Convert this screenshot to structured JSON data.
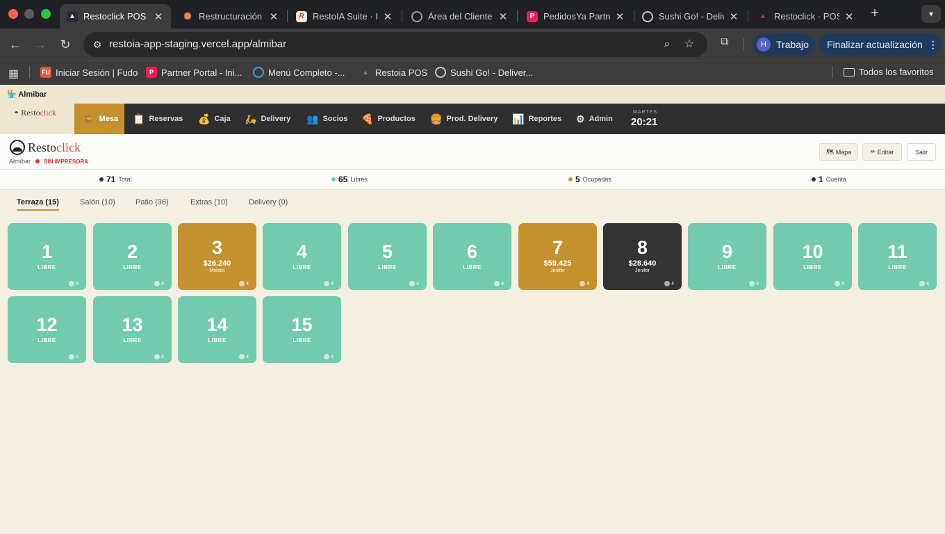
{
  "browser": {
    "tabs": [
      {
        "title": "Restoclick POS",
        "active": true
      },
      {
        "title": "Restructuración",
        "active": false
      },
      {
        "title": "RestoIA Suite · IA",
        "active": false
      },
      {
        "title": "Área del Cliente",
        "active": false
      },
      {
        "title": "PedidosYa Partner",
        "active": false
      },
      {
        "title": "Sushi Go! - Deliv",
        "active": false
      },
      {
        "title": "Restoclick · POS",
        "active": false
      }
    ],
    "url": "restoia-app-staging.vercel.app/almibar",
    "profile_label": "Trabajo",
    "profile_initial": "H",
    "update_label": "Finalizar actualización",
    "bookmarks": [
      {
        "label": "Iniciar Sesión | Fudo"
      },
      {
        "label": "Partner Portal - Ini..."
      },
      {
        "label": "Menú Completo -..."
      },
      {
        "label": "Restoia POS"
      },
      {
        "label": "Sushi Go! - Deliver..."
      }
    ],
    "all_bookmarks_label": "Todos los favoritos"
  },
  "app": {
    "venue_title": "Almibar",
    "nav": {
      "logo": {
        "part1": "Resto",
        "part2": "click"
      },
      "items": [
        {
          "label": "Mesa",
          "icon": "chair-icon",
          "active": true
        },
        {
          "label": "Reservas",
          "icon": "clipboard-icon"
        },
        {
          "label": "Caja",
          "icon": "money-bag-icon"
        },
        {
          "label": "Delivery",
          "icon": "scooter-icon"
        },
        {
          "label": "Socios",
          "icon": "people-icon"
        },
        {
          "label": "Productos",
          "icon": "pizza-icon"
        },
        {
          "label": "Prod. Delivery",
          "icon": "burger-icon"
        },
        {
          "label": "Reportes",
          "icon": "chart-icon"
        },
        {
          "label": "Admin",
          "icon": "gear-icon"
        }
      ],
      "day": "MARTES",
      "time": "20:21"
    },
    "header": {
      "brand": {
        "part1": "Resto",
        "part2": "click"
      },
      "venue": "Almíbar",
      "printer_status": "SIN IMPRESORA",
      "buttons": {
        "map": "Mapa",
        "edit": "Editar",
        "exit": "Salir"
      }
    },
    "stats": [
      {
        "value": "71",
        "label": "Total",
        "color": "#333333"
      },
      {
        "value": "65",
        "label": "Libres",
        "color": "#72cbae"
      },
      {
        "value": "5",
        "label": "Ocupadas",
        "color": "#c4912e"
      },
      {
        "value": "1",
        "label": "Cuenta",
        "color": "#333333"
      }
    ],
    "area_tabs": [
      {
        "label": "Terraza (15)",
        "active": true
      },
      {
        "label": "Salón (10)"
      },
      {
        "label": "Patio (36)"
      },
      {
        "label": "Extras (10)"
      },
      {
        "label": "Delivery (0)"
      }
    ],
    "tables": [
      {
        "number": "1",
        "status": "LIBRE",
        "capacity": "4"
      },
      {
        "number": "2",
        "status": "LIBRE",
        "capacity": "4"
      },
      {
        "number": "3",
        "status": "occupied",
        "amount": "$26.240",
        "waiter": "Moises",
        "capacity": "4"
      },
      {
        "number": "4",
        "status": "LIBRE",
        "capacity": "4"
      },
      {
        "number": "5",
        "status": "LIBRE",
        "capacity": "4"
      },
      {
        "number": "6",
        "status": "LIBRE",
        "capacity": "4"
      },
      {
        "number": "7",
        "status": "occupied",
        "amount": "$59.425",
        "waiter": "Jenifer",
        "capacity": "4"
      },
      {
        "number": "8",
        "status": "account",
        "amount": "$28.640",
        "waiter": "Jenifer",
        "capacity": "4"
      },
      {
        "number": "9",
        "status": "LIBRE",
        "capacity": "4"
      },
      {
        "number": "10",
        "status": "LIBRE",
        "capacity": "4"
      },
      {
        "number": "11",
        "status": "LIBRE",
        "capacity": "4"
      },
      {
        "number": "12",
        "status": "LIBRE",
        "capacity": "4"
      },
      {
        "number": "13",
        "status": "LIBRE",
        "capacity": "4"
      },
      {
        "number": "14",
        "status": "LIBRE",
        "capacity": "4"
      },
      {
        "number": "15",
        "status": "LIBRE",
        "capacity": "4"
      }
    ],
    "colors": {
      "free": "#72cbae",
      "occupied": "#c4912e",
      "account": "#333333",
      "accent": "#c4912e"
    }
  }
}
